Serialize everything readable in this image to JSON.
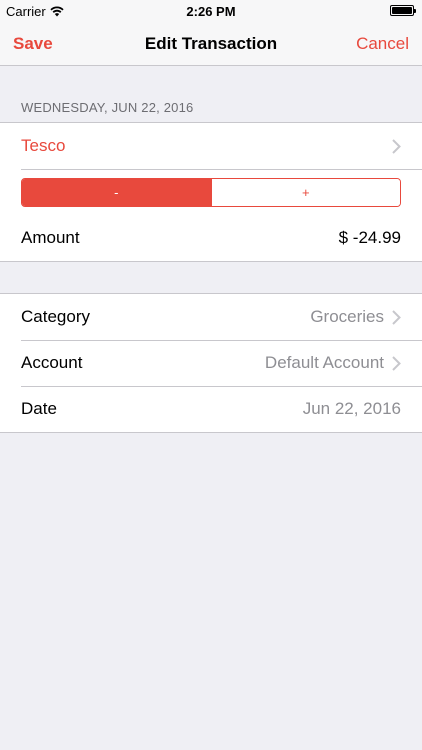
{
  "status_bar": {
    "carrier": "Carrier",
    "time": "2:26 PM"
  },
  "nav": {
    "save_label": "Save",
    "title": "Edit Transaction",
    "cancel_label": "Cancel"
  },
  "transaction": {
    "date_header": "WEDNESDAY, JUN 22, 2016",
    "payee": "Tesco",
    "segments": {
      "minus": "-",
      "plus": "+",
      "selected": "minus"
    },
    "amount_label": "Amount",
    "amount_value": "$ -24.99"
  },
  "details": {
    "category_label": "Category",
    "category_value": "Groceries",
    "account_label": "Account",
    "account_value": "Default Account",
    "date_label": "Date",
    "date_value": "Jun 22, 2016"
  },
  "colors": {
    "accent": "#e8493d",
    "background": "#efeff4",
    "secondary_text": "#8e8e93"
  }
}
